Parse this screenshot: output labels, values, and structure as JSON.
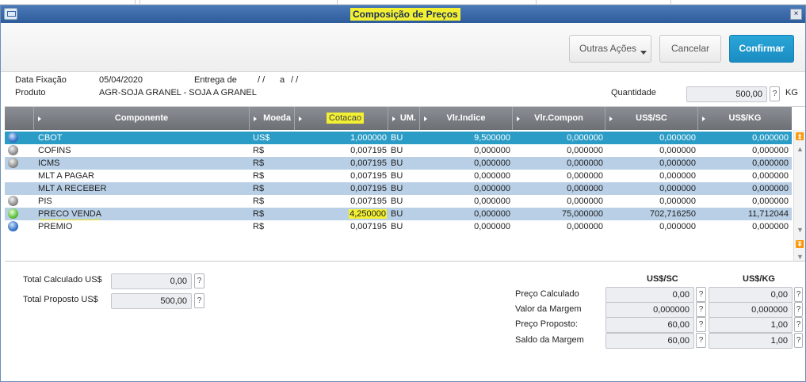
{
  "window": {
    "title": "Composição de Preços",
    "close_glyph": "×"
  },
  "toolbar": {
    "other_actions": "Outras Ações",
    "cancel": "Cancelar",
    "confirm": "Confirmar"
  },
  "info": {
    "data_fixacao_label": "Data Fixação",
    "data_fixacao_value": "05/04/2020",
    "entrega_label": "Entrega de",
    "entrega_from": "/ /",
    "entrega_sep": "a",
    "entrega_to": "/ /",
    "produto_label": "Produto",
    "produto_value": "AGR-SOJA GRANEL - SOJA A GRANEL",
    "quantidade_label": "Quantidade",
    "quantidade_value": "500,00",
    "quantidade_unit": "KG",
    "help": "?"
  },
  "grid": {
    "columns": [
      "Componente",
      "Moeda",
      "Cotacao",
      "UM.",
      "Vlr.Indice",
      "Vlr.Compon",
      "US$/SC",
      "US$/KG"
    ],
    "rows": [
      {
        "status": "blue",
        "componente": "CBOT",
        "moeda": "US$",
        "cotacao": "1,000000",
        "um": "BU",
        "vlr_indice": "9,500000",
        "vlr_compon": "0,000000",
        "us_sc": "0,000000",
        "us_kg": "0,000000"
      },
      {
        "status": "gray",
        "componente": "COFINS",
        "moeda": "R$",
        "cotacao": "0,007195",
        "um": "BU",
        "vlr_indice": "0,000000",
        "vlr_compon": "0,000000",
        "us_sc": "0,000000",
        "us_kg": "0,000000"
      },
      {
        "status": "gray",
        "componente": "ICMS",
        "moeda": "R$",
        "cotacao": "0,007195",
        "um": "BU",
        "vlr_indice": "0,000000",
        "vlr_compon": "0,000000",
        "us_sc": "0,000000",
        "us_kg": "0,000000"
      },
      {
        "status": "none",
        "componente": "MLT A PAGAR",
        "moeda": "R$",
        "cotacao": "0,007195",
        "um": "BU",
        "vlr_indice": "0,000000",
        "vlr_compon": "0,000000",
        "us_sc": "0,000000",
        "us_kg": "0,000000"
      },
      {
        "status": "none",
        "componente": "MLT A RECEBER",
        "moeda": "R$",
        "cotacao": "0,007195",
        "um": "BU",
        "vlr_indice": "0,000000",
        "vlr_compon": "0,000000",
        "us_sc": "0,000000",
        "us_kg": "0,000000"
      },
      {
        "status": "gray",
        "componente": "PIS",
        "moeda": "R$",
        "cotacao": "0,007195",
        "um": "BU",
        "vlr_indice": "0,000000",
        "vlr_compon": "0,000000",
        "us_sc": "0,000000",
        "us_kg": "0,000000"
      },
      {
        "status": "green",
        "componente": "PRECO VENDA",
        "moeda": "R$",
        "cotacao": "4,250000",
        "um": "BU",
        "vlr_indice": "0,000000",
        "vlr_compon": "75,000000",
        "us_sc": "702,716250",
        "us_kg": "11,712044"
      },
      {
        "status": "blue",
        "componente": "PREMIO",
        "moeda": "R$",
        "cotacao": "0,007195",
        "um": "BU",
        "vlr_indice": "0,000000",
        "vlr_compon": "0,000000",
        "us_sc": "0,000000",
        "us_kg": "0,000000"
      }
    ]
  },
  "totals": {
    "calc_label": "Total Calculado US$",
    "calc_value": "0,00",
    "prop_label": "Total Proposto US$",
    "prop_value": "500,00"
  },
  "summary": {
    "col_sc": "US$/SC",
    "col_kg": "US$/KG",
    "rows": [
      {
        "label": "Preço Calculado",
        "sc": "0,00",
        "kg": "0,00"
      },
      {
        "label": "Valor da Margem",
        "sc": "0,000000",
        "kg": "0,000000"
      },
      {
        "label": "Preço Proposto:",
        "sc": "60,00",
        "kg": "1,00"
      },
      {
        "label": "Saldo da Margem",
        "sc": "60,00",
        "kg": "1,00"
      }
    ]
  },
  "scroll_glyphs": {
    "top": "⏫",
    "up": "▲",
    "down": "▼",
    "bottom": "⏬"
  }
}
